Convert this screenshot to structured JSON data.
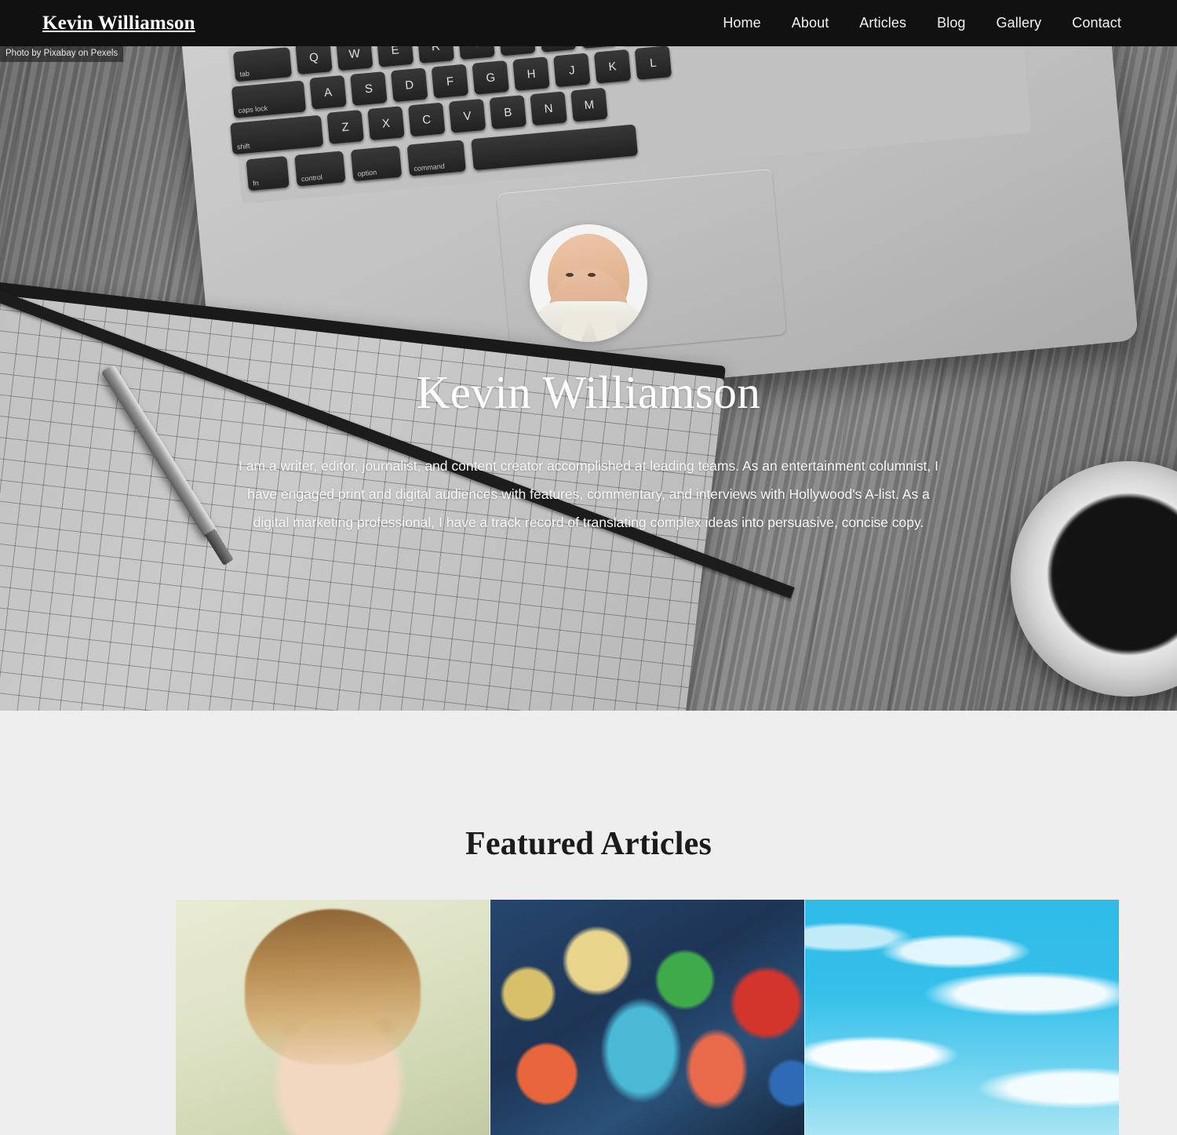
{
  "header": {
    "brand": "Kevin Williamson",
    "nav": [
      {
        "label": "Home",
        "name": "nav-home"
      },
      {
        "label": "About",
        "name": "nav-about"
      },
      {
        "label": "Articles",
        "name": "nav-articles"
      },
      {
        "label": "Blog",
        "name": "nav-blog"
      },
      {
        "label": "Gallery",
        "name": "nav-gallery"
      },
      {
        "label": "Contact",
        "name": "nav-contact"
      }
    ]
  },
  "hero": {
    "photo_credit": "Photo by Pixabay on Pexels",
    "avatar_alt": "portrait-photo",
    "title": "Kevin Williamson",
    "bio": "I am a writer, editor, journalist, and content creator accomplished at leading teams. As an entertainment columnist, I have engaged print and digital audiences with features, commentary, and interviews with Hollywood's A-list. As a digital marketing professional, I have a track record of translating complex ideas into persuasive, concise copy.",
    "background_image": "grayscale-laptop-keyboard-notebook-pen-coffee-on-wooden-desk"
  },
  "featured": {
    "title": "Featured Articles",
    "cards": [
      {
        "image": "blonde-woman-portrait",
        "name": "featured-card-1"
      },
      {
        "image": "muppets-colorful-cast",
        "name": "featured-card-2"
      },
      {
        "image": "blue-sky-with-clouds",
        "name": "featured-card-3"
      }
    ]
  },
  "colors": {
    "header_bg": "#111111",
    "page_bg": "#eeeeee",
    "text_light": "#ffffff",
    "text_dark": "#1b1b1b"
  }
}
